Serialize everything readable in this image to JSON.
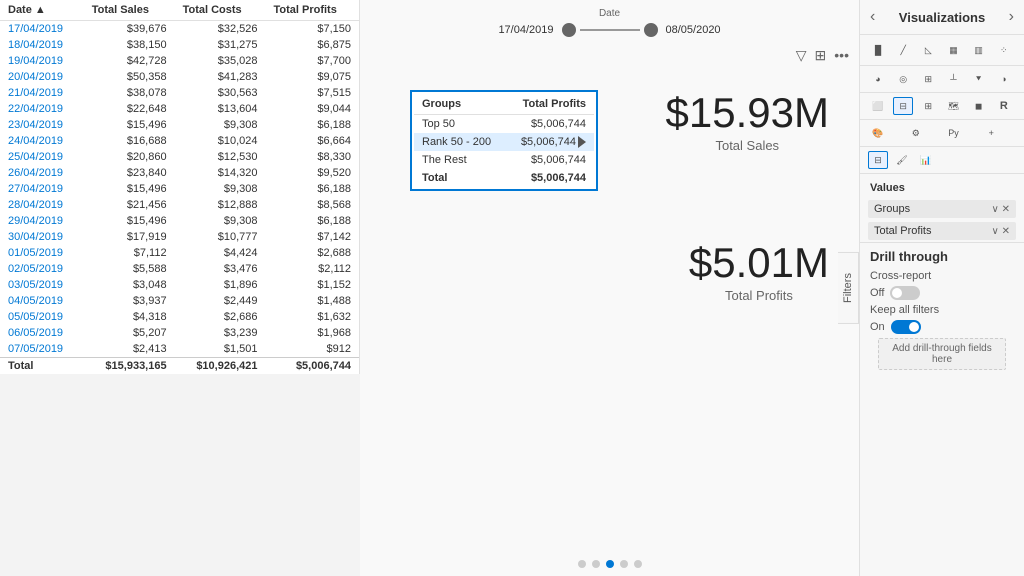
{
  "left_table": {
    "headers": [
      "Date",
      "Total Sales",
      "Total Costs",
      "Total Profits"
    ],
    "rows": [
      [
        "17/04/2019",
        "$39,676",
        "$32,526",
        "$7,150"
      ],
      [
        "18/04/2019",
        "$38,150",
        "$31,275",
        "$6,875"
      ],
      [
        "19/04/2019",
        "$42,728",
        "$35,028",
        "$7,700"
      ],
      [
        "20/04/2019",
        "$50,358",
        "$41,283",
        "$9,075"
      ],
      [
        "21/04/2019",
        "$38,078",
        "$30,563",
        "$7,515"
      ],
      [
        "22/04/2019",
        "$22,648",
        "$13,604",
        "$9,044"
      ],
      [
        "23/04/2019",
        "$15,496",
        "$9,308",
        "$6,188"
      ],
      [
        "24/04/2019",
        "$16,688",
        "$10,024",
        "$6,664"
      ],
      [
        "25/04/2019",
        "$20,860",
        "$12,530",
        "$8,330"
      ],
      [
        "26/04/2019",
        "$23,840",
        "$14,320",
        "$9,520"
      ],
      [
        "27/04/2019",
        "$15,496",
        "$9,308",
        "$6,188"
      ],
      [
        "28/04/2019",
        "$21,456",
        "$12,888",
        "$8,568"
      ],
      [
        "29/04/2019",
        "$15,496",
        "$9,308",
        "$6,188"
      ],
      [
        "30/04/2019",
        "$17,919",
        "$10,777",
        "$7,142"
      ],
      [
        "01/05/2019",
        "$7,112",
        "$4,424",
        "$2,688"
      ],
      [
        "02/05/2019",
        "$5,588",
        "$3,476",
        "$2,112"
      ],
      [
        "03/05/2019",
        "$3,048",
        "$1,896",
        "$1,152"
      ],
      [
        "04/05/2019",
        "$3,937",
        "$2,449",
        "$1,488"
      ],
      [
        "05/05/2019",
        "$4,318",
        "$2,686",
        "$1,632"
      ],
      [
        "06/05/2019",
        "$5,207",
        "$3,239",
        "$1,968"
      ],
      [
        "07/05/2019",
        "$2,413",
        "$1,501",
        "$912"
      ]
    ],
    "total_row": [
      "Total",
      "$15,933,165",
      "$10,926,421",
      "$5,006,744"
    ]
  },
  "popup_table": {
    "headers": [
      "Groups",
      "Total Profits"
    ],
    "rows": [
      {
        "group": "Top 50",
        "profits": "$5,006,744",
        "highlight": false
      },
      {
        "group": "Rank 50 - 200",
        "profits": "$5,006,744",
        "highlight": true
      },
      {
        "group": "The Rest",
        "profits": "$5,006,744",
        "highlight": false
      }
    ],
    "total_row": {
      "label": "Total",
      "value": "$5,006,744"
    }
  },
  "date_filter": {
    "label": "Date",
    "start": "17/04/2019",
    "end": "08/05/2020"
  },
  "kpi1": {
    "value": "$15.93M",
    "label": "Total Sales"
  },
  "kpi2": {
    "value": "$5.01M",
    "label": "Total Profits"
  },
  "visualizations": {
    "title": "Visualizations",
    "chevron_left": "‹",
    "chevron_right": "›"
  },
  "values_section": {
    "label": "Values",
    "fields": [
      {
        "name": "Groups"
      },
      {
        "name": "Total Profits"
      }
    ]
  },
  "drill_through": {
    "title": "Drill through",
    "cross_report": {
      "label": "Cross-report",
      "toggle_state": "Off",
      "is_on": false
    },
    "keep_all_filters": {
      "label": "Keep all filters",
      "toggle_state": "On",
      "is_on": true
    },
    "add_field_label": "Add drill-through fields here"
  },
  "filters_tab": {
    "label": "Filters"
  },
  "page_nav": {
    "dots": [
      false,
      false,
      true,
      false,
      false
    ]
  }
}
